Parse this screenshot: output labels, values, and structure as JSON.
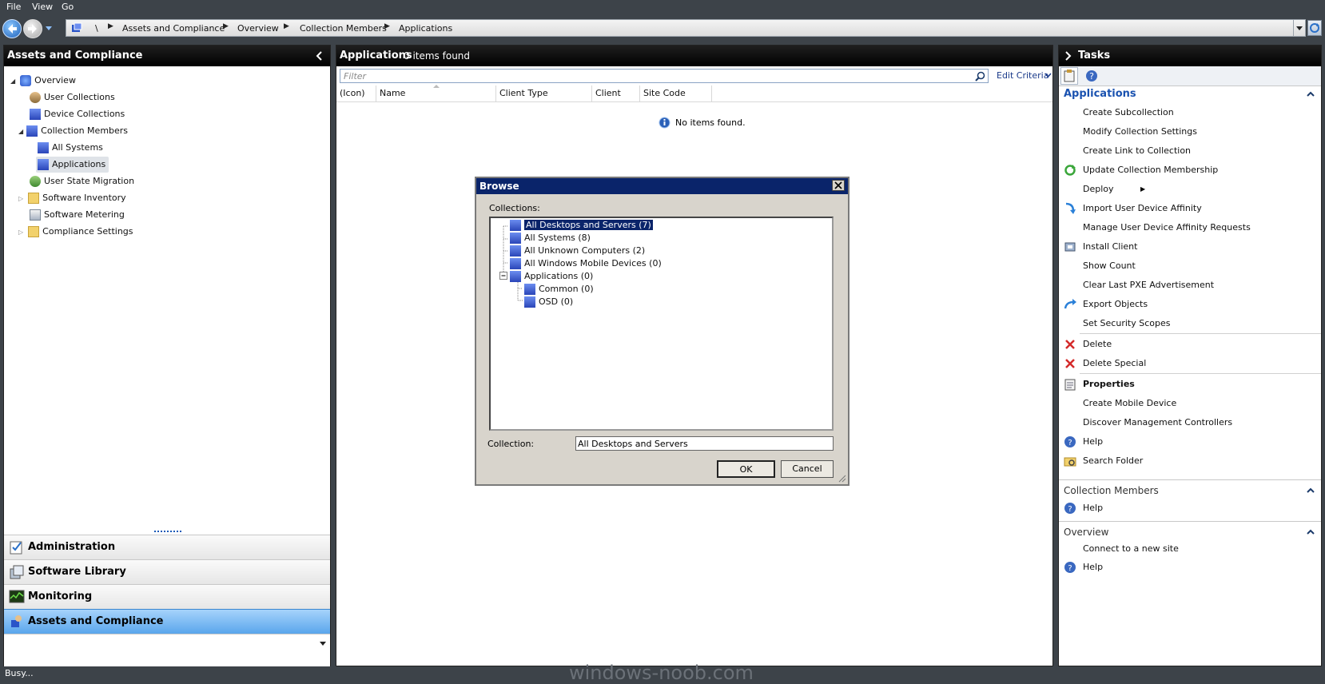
{
  "menu": {
    "file": "File",
    "view": "View",
    "go": "Go"
  },
  "address": {
    "root": "\\",
    "crumbs": [
      "Assets and Compliance",
      "Overview",
      "Collection Members",
      "Applications"
    ]
  },
  "left": {
    "title": "Assets and Compliance",
    "tree": [
      {
        "label": "Overview"
      },
      {
        "label": "User Collections"
      },
      {
        "label": "Device Collections"
      },
      {
        "label": "Collection Members"
      },
      {
        "label": "All Systems"
      },
      {
        "label": "Applications"
      },
      {
        "label": "User State Migration"
      },
      {
        "label": "Software Inventory"
      },
      {
        "label": "Software Metering"
      },
      {
        "label": "Compliance Settings"
      }
    ],
    "workspaces": [
      "Administration",
      "Software Library",
      "Monitoring",
      "Assets and Compliance"
    ]
  },
  "center": {
    "title": "Applications",
    "count": "0 items found",
    "filter_placeholder": "Filter",
    "edit_criteria": "Edit Criteria",
    "columns": [
      "(Icon)",
      "Name",
      "Client Type",
      "Client",
      "Site Code"
    ],
    "empty_text": "No items found."
  },
  "dialog": {
    "title": "Browse",
    "collections_label": "Collections:",
    "items": [
      "All Desktops and Servers (7)",
      "All Systems (8)",
      "All Unknown Computers (2)",
      "All Windows Mobile Devices (0)",
      "Applications (0)",
      "Common (0)",
      "OSD (0)"
    ],
    "collection_label": "Collection:",
    "collection_value": "All Desktops and Servers",
    "ok": "OK",
    "cancel": "Cancel"
  },
  "right": {
    "title": "Tasks",
    "section1": "Applications",
    "tasks": [
      "Create Subcollection",
      "Modify Collection Settings",
      "Create Link to Collection",
      "Update Collection Membership",
      "Deploy",
      "Import User Device Affinity",
      "Manage User Device Affinity Requests",
      "Install Client",
      "Show Count",
      "Clear Last PXE Advertisement",
      "Export Objects",
      "Set Security Scopes",
      "Delete",
      "Delete Special",
      "Properties",
      "Create Mobile Device",
      "Discover Management Controllers",
      "Help",
      "Search Folder"
    ],
    "section2": "Collection Members",
    "section2_tasks": [
      "Help"
    ],
    "section3": "Overview",
    "section3_tasks": [
      "Connect to a new site",
      "Help"
    ]
  },
  "status": {
    "text": "Busy..."
  },
  "watermark": "windows-noob.com",
  "colors": {
    "selection": "#0a246a",
    "workspace_selected": "#6fb4f0",
    "title_bar": "#0a246a"
  }
}
